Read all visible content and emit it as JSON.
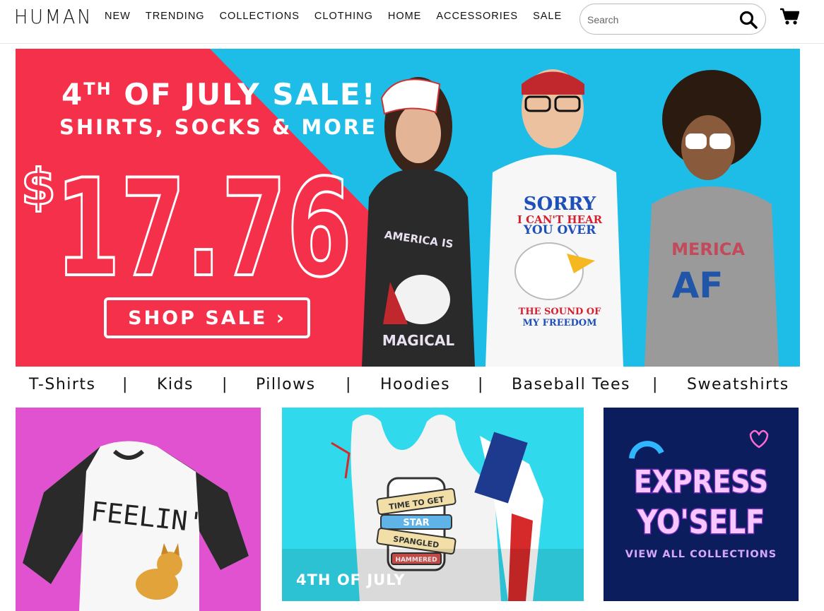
{
  "header": {
    "logo": "HUMAN",
    "nav": [
      "NEW",
      "TRENDING",
      "COLLECTIONS",
      "CLOTHING",
      "HOME",
      "ACCESSORIES",
      "SALE"
    ],
    "search_placeholder": "Search",
    "icons": {
      "search": "search-icon",
      "cart": "cart-icon"
    }
  },
  "hero": {
    "line1_prefix": "4",
    "line1_sup": "TH",
    "line1_suffix": " OF JULY SALE!",
    "line2": "SHIRTS, SOCKS & MORE",
    "price_symbol": "$",
    "price": "17.76",
    "cta": "SHOP SALE ›",
    "shirt_text": {
      "left_tank": [
        "AMERICA IS",
        "MAGICAL"
      ],
      "center_tee": [
        "SORRY",
        "I CAN'T HEAR",
        "YOU OVER",
        "THE SOUND OF",
        "MY FREEDOM"
      ],
      "right_tank": [
        "MERICA",
        "AF"
      ]
    },
    "colors": {
      "red": "#f5304a",
      "blue": "#1ebde8"
    }
  },
  "categories": [
    "T-Shirts",
    "Kids",
    "Pillows",
    "Hoodies",
    "Baseball Tees",
    "Sweatshirts"
  ],
  "separator": "|",
  "tiles": {
    "tile1": {
      "shirt_text": "FEELIN'"
    },
    "tile2": {
      "label": "4TH OF JULY",
      "can_text": [
        "TIME TO GET",
        "STAR",
        "SPANGLED",
        "HAMMERED"
      ]
    },
    "tile3": {
      "title_line1": "EXPRESS",
      "title_line2": "YO'SELF",
      "link": "VIEW ALL COLLECTIONS"
    }
  }
}
